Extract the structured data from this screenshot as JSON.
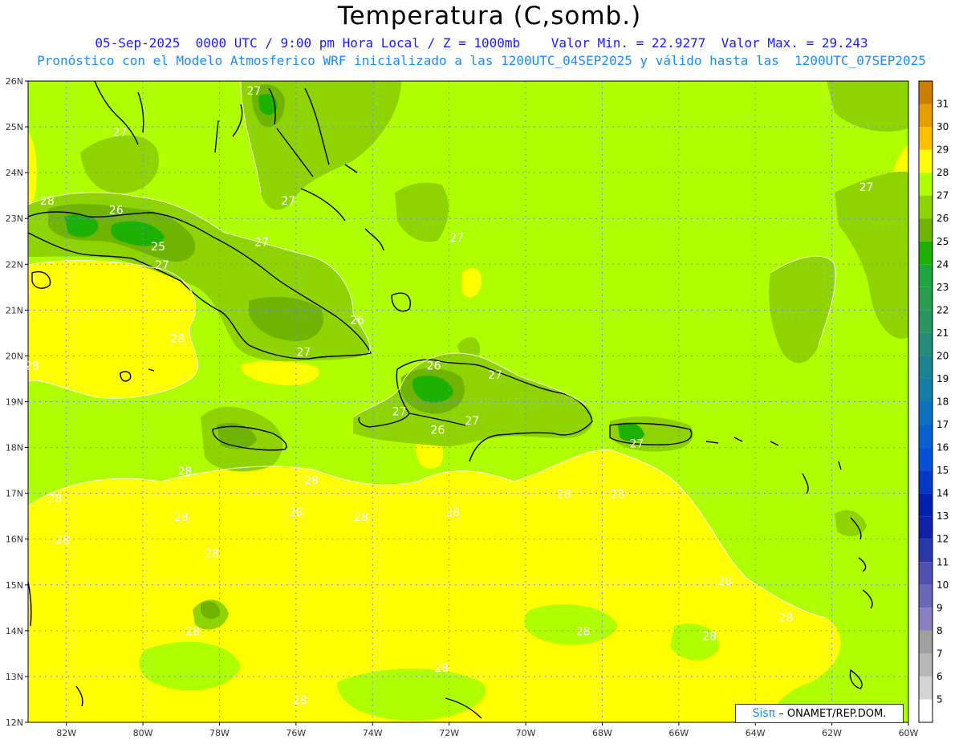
{
  "header": {
    "title": "Temperatura (C,somb.)",
    "line1": "05-Sep-2025  0000 UTC / 9:00 pm Hora Local / Z = 1000mb    Valor Min. = 22.9277  Valor Max. = 29.243",
    "line2": "Pronóstico con el Modelo Atmosferico WRF inicializado a las 1200UTC_04SEP2025 y válido hasta las  1200UTC_07SEP2025"
  },
  "map": {
    "lon_range": [
      -83,
      -60
    ],
    "lat_range": [
      12,
      26
    ],
    "lat_labels": [
      "26N",
      "25N",
      "24N",
      "23N",
      "22N",
      "21N",
      "20N",
      "19N",
      "18N",
      "17N",
      "16N",
      "15N",
      "14N",
      "13N",
      "12N"
    ],
    "lon_labels": [
      "82W",
      "80W",
      "78W",
      "76W",
      "74W",
      "72W",
      "70W",
      "68W",
      "66W",
      "64W",
      "62W",
      "60W"
    ],
    "contour_labels": [
      {
        "text": "27",
        "lon": -77.1,
        "lat": 25.7
      },
      {
        "text": "27",
        "lon": -80.6,
        "lat": 24.8
      },
      {
        "text": "28",
        "lon": -82.5,
        "lat": 23.3
      },
      {
        "text": "26",
        "lon": -80.7,
        "lat": 23.1
      },
      {
        "text": "25",
        "lon": -79.6,
        "lat": 22.3
      },
      {
        "text": "27",
        "lon": -79.5,
        "lat": 21.9
      },
      {
        "text": "27",
        "lon": -76.9,
        "lat": 22.4
      },
      {
        "text": "27",
        "lon": -76.2,
        "lat": 23.3
      },
      {
        "text": "27",
        "lon": -71.8,
        "lat": 22.5
      },
      {
        "text": "27",
        "lon": -61.1,
        "lat": 23.6
      },
      {
        "text": "26",
        "lon": -74.4,
        "lat": 20.7
      },
      {
        "text": "27",
        "lon": -75.8,
        "lat": 20.0
      },
      {
        "text": "28",
        "lon": -79.1,
        "lat": 20.3
      },
      {
        "text": "28",
        "lon": -82.9,
        "lat": 19.7
      },
      {
        "text": "26",
        "lon": -72.4,
        "lat": 19.7
      },
      {
        "text": "27",
        "lon": -70.8,
        "lat": 19.5
      },
      {
        "text": "27",
        "lon": -73.3,
        "lat": 18.7
      },
      {
        "text": "26",
        "lon": -72.3,
        "lat": 18.3
      },
      {
        "text": "27",
        "lon": -71.4,
        "lat": 18.5
      },
      {
        "text": "27",
        "lon": -67.1,
        "lat": 18.0
      },
      {
        "text": "28",
        "lon": -78.9,
        "lat": 17.4
      },
      {
        "text": "28",
        "lon": -75.6,
        "lat": 17.2
      },
      {
        "text": "28",
        "lon": -74.3,
        "lat": 16.4
      },
      {
        "text": "28",
        "lon": -82.3,
        "lat": 16.8
      },
      {
        "text": "28",
        "lon": -79.0,
        "lat": 16.4
      },
      {
        "text": "28",
        "lon": -76.0,
        "lat": 16.5
      },
      {
        "text": "28",
        "lon": -71.9,
        "lat": 16.5
      },
      {
        "text": "28",
        "lon": -69.0,
        "lat": 16.9
      },
      {
        "text": "28",
        "lon": -67.6,
        "lat": 16.9
      },
      {
        "text": "28",
        "lon": -82.1,
        "lat": 15.9
      },
      {
        "text": "28",
        "lon": -78.2,
        "lat": 15.6
      },
      {
        "text": "28",
        "lon": -64.8,
        "lat": 15.0
      },
      {
        "text": "28",
        "lon": -63.2,
        "lat": 14.2
      },
      {
        "text": "28",
        "lon": -78.7,
        "lat": 13.9
      },
      {
        "text": "28",
        "lon": -68.5,
        "lat": 13.9
      },
      {
        "text": "28",
        "lon": -65.2,
        "lat": 13.8
      },
      {
        "text": "28",
        "lon": -72.2,
        "lat": 13.1
      },
      {
        "text": "28",
        "lon": -75.9,
        "lat": 12.4
      }
    ]
  },
  "colorbar": {
    "levels": [
      {
        "label": "31",
        "color": "#c98000"
      },
      {
        "label": "30",
        "color": "#e5a000"
      },
      {
        "label": "29",
        "color": "#ffc000"
      },
      {
        "label": "28",
        "color": "#ffff00"
      },
      {
        "label": "27",
        "color": "#b0ff00"
      },
      {
        "label": "26",
        "color": "#8fd400"
      },
      {
        "label": "25",
        "color": "#6eb400"
      },
      {
        "label": "24",
        "color": "#1cb000"
      },
      {
        "label": "23",
        "color": "#20a640"
      },
      {
        "label": "22",
        "color": "#2a9c50"
      },
      {
        "label": "21",
        "color": "#299460"
      },
      {
        "label": "20",
        "color": "#248c78"
      },
      {
        "label": "19",
        "color": "#1c8490"
      },
      {
        "label": "18",
        "color": "#167ca8"
      },
      {
        "label": "17",
        "color": "#1070c0"
      },
      {
        "label": "16",
        "color": "#0a60d0"
      },
      {
        "label": "15",
        "color": "#0550d8"
      },
      {
        "label": "14",
        "color": "#0038c8"
      },
      {
        "label": "13",
        "color": "#0020b0"
      },
      {
        "label": "12",
        "color": "#1020a8"
      },
      {
        "label": "11",
        "color": "#2838a8"
      },
      {
        "label": "10",
        "color": "#5050b0"
      },
      {
        "label": "9",
        "color": "#6c68b8"
      },
      {
        "label": "8",
        "color": "#8880c0"
      },
      {
        "label": "7",
        "color": "#a0a0a0"
      },
      {
        "label": "6",
        "color": "#b8b8b8"
      },
      {
        "label": "5",
        "color": "#d4d4d4"
      }
    ],
    "bottom_color": "#ffffff"
  },
  "credit": {
    "brand": "Sis",
    "pi": "π",
    "org": " – ONAMET/REP.DOM."
  }
}
